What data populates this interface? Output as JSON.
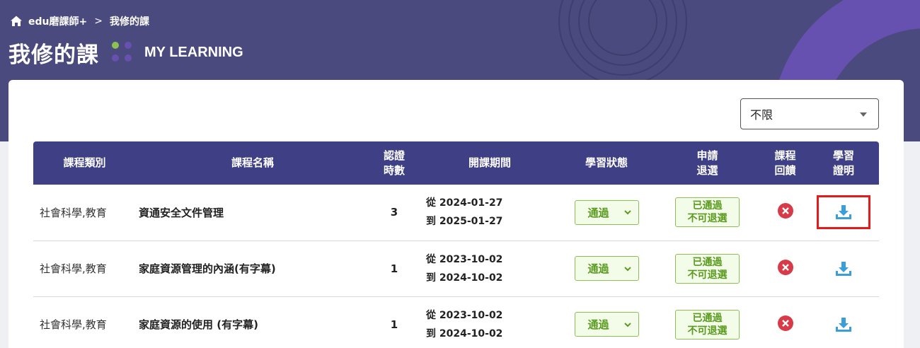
{
  "breadcrumb": {
    "home": "edu磨課師+",
    "separator": ">",
    "current": "我修的課"
  },
  "header": {
    "title": "我修的課",
    "subtitle": "MY LEARNING"
  },
  "filter": {
    "selected": "不限"
  },
  "table": {
    "columns": {
      "category": "課程類別",
      "name": "課程名稱",
      "hours_1": "認證",
      "hours_2": "時數",
      "period": "開課期間",
      "status": "學習狀態",
      "withdraw_1": "申請",
      "withdraw_2": "退選",
      "feedback_1": "課程",
      "feedback_2": "回饋",
      "certificate_1": "學習",
      "certificate_2": "證明"
    },
    "rows": [
      {
        "category": "社會科學,教育",
        "name": "資通安全文件管理",
        "hours": "3",
        "from": "從 2024-01-27",
        "to": "到 2025-01-27",
        "status": "通過",
        "withdraw_1": "已通過",
        "withdraw_2": "不可退選"
      },
      {
        "category": "社會科學,教育",
        "name": "家庭資源管理的內涵(有字幕)",
        "hours": "1",
        "from": "從 2023-10-02",
        "to": "到 2024-10-02",
        "status": "通過",
        "withdraw_1": "已通過",
        "withdraw_2": "不可退選"
      },
      {
        "category": "社會科學,教育",
        "name": "家庭資源的使用 (有字幕)",
        "hours": "1",
        "from": "從 2023-10-02",
        "to": "到 2024-10-02",
        "status": "通過",
        "withdraw_1": "已通過",
        "withdraw_2": "不可退選"
      }
    ]
  },
  "icons": {
    "home": "home-icon",
    "feedback": "close-circle-icon",
    "certificate": "download-icon",
    "status_dropdown": "chevron-down-icon"
  },
  "colors": {
    "header_bg": "#4a4a7e",
    "table_header_bg": "#3f3f85",
    "pass_green": "#5a9a1e",
    "x_red": "#d93a48",
    "download_blue": "#3a9fd8",
    "highlight_red": "#e41b1b"
  }
}
